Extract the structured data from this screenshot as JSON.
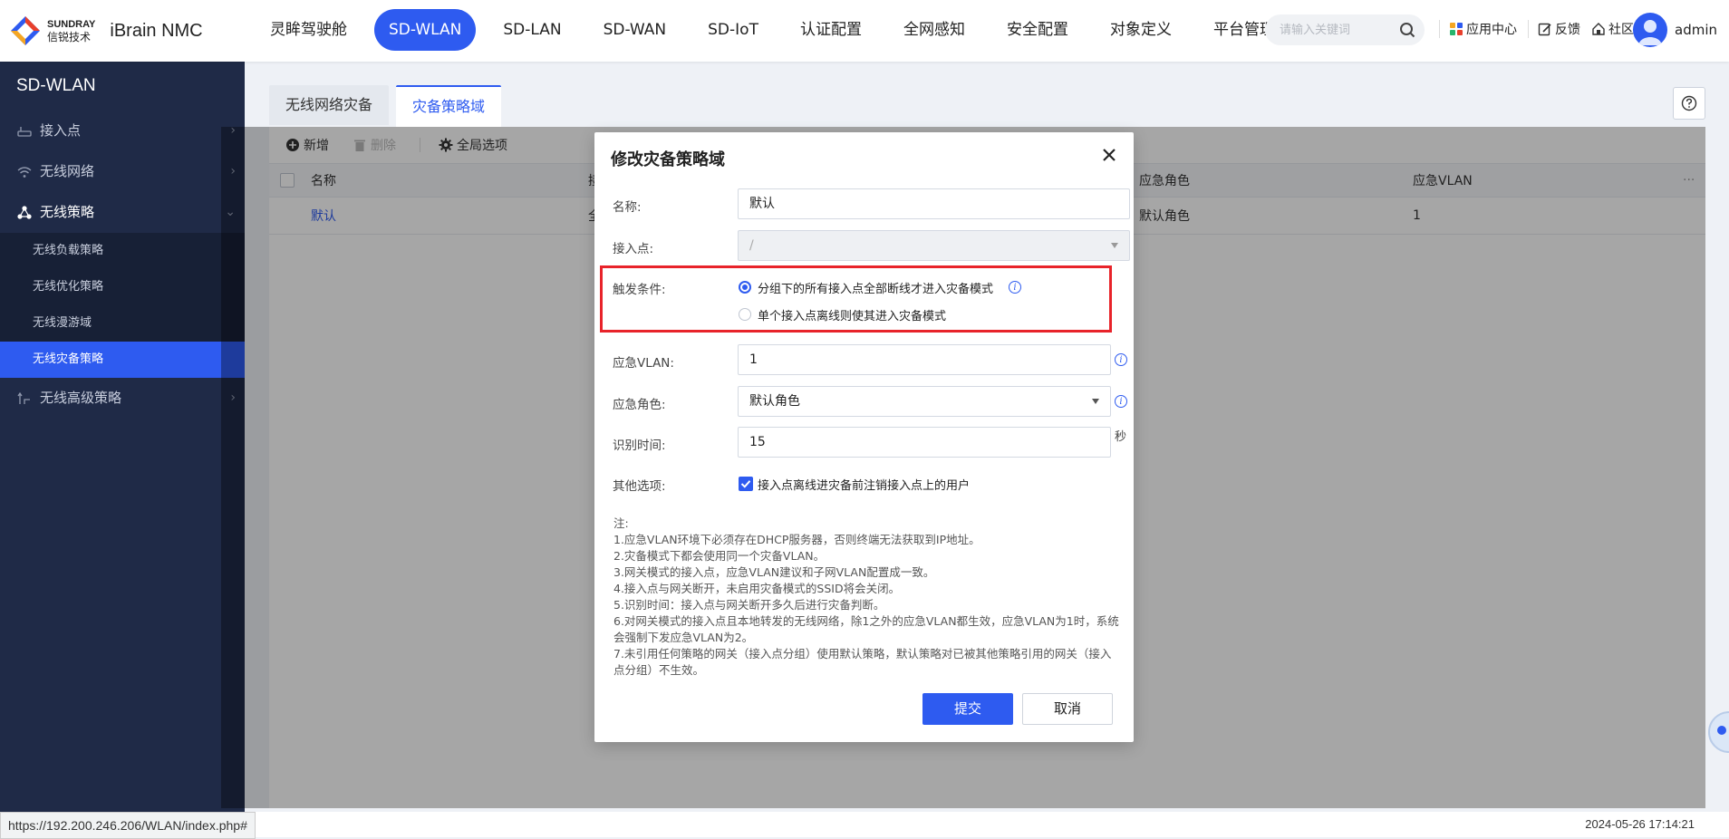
{
  "header": {
    "brand_en": "SUNDRAY",
    "brand_cn": "信锐技术",
    "product": "iBrain NMC",
    "nav": [
      "灵眸驾驶舱",
      "SD-WLAN",
      "SD-LAN",
      "SD-WAN",
      "SD-IoT",
      "认证配置",
      "全网感知",
      "安全配置",
      "对象定义",
      "平台管理"
    ],
    "nav_active": "SD-WLAN",
    "search_placeholder": "请输入关键词",
    "tools": {
      "app_center": "应用中心",
      "feedback": "反馈",
      "community": "社区"
    },
    "user": "admin"
  },
  "sidebar": {
    "title": "SD-WLAN",
    "items": [
      {
        "label": "接入点",
        "icon": "router-icon"
      },
      {
        "label": "无线网络",
        "icon": "wifi-icon"
      },
      {
        "label": "无线策略",
        "icon": "policy-icon",
        "open": true
      },
      {
        "label": "无线高级策略",
        "icon": "advanced-icon"
      }
    ],
    "sub_items": [
      "无线负载策略",
      "无线优化策略",
      "无线漫游域",
      "无线灾备策略"
    ],
    "sub_active": "无线灾备策略"
  },
  "tabs": [
    "无线网络灾备",
    "灾备策略域"
  ],
  "tab_active": "灾备策略域",
  "toolbar": {
    "add": "新增",
    "delete": "删除",
    "global": "全局选项"
  },
  "table": {
    "headers": [
      "名称",
      "接",
      "应急角色",
      "应急VLAN"
    ],
    "more": "···",
    "rows": [
      {
        "name": "默认",
        "ap": "全",
        "role": "默认角色",
        "vlan": "1"
      }
    ]
  },
  "modal": {
    "title": "修改灾备策略域",
    "name_label": "名称:",
    "name_value": "默认",
    "ap_label": "接入点:",
    "ap_value": "/",
    "trigger_label": "触发条件:",
    "trigger_option1": "分组下的所有接入点全部断线才进入灾备模式",
    "trigger_option2": "单个接入点离线则使其进入灾备模式",
    "trigger_selected": 1,
    "vlan_label": "应急VLAN:",
    "vlan_value": "1",
    "role_label": "应急角色:",
    "role_value": "默认角色",
    "time_label": "识别时间:",
    "time_value": "15",
    "time_unit": "秒",
    "other_label": "其他选项:",
    "other_option": "接入点离线进灾备前注销接入点上的用户",
    "other_checked": true,
    "notes": [
      "注:",
      "1.应急VLAN环境下必须存在DHCP服务器，否则终端无法获取到IP地址。",
      "2.灾备模式下都会使用同一个灾备VLAN。",
      "3.网关模式的接入点，应急VLAN建议和子网VLAN配置成一致。",
      "4.接入点与网关断开，未启用灾备模式的SSID将会关闭。",
      "5.识别时间：接入点与网关断开多久后进行灾备判断。",
      "6.对网关模式的接入点且本地转发的无线网络，除1之外的应急VLAN都生效，应急VLAN为1时，系统会强制下发应急VLAN为2。",
      "7.未引用任何策略的网关（接入点分组）使用默认策略，默认策略对已被其他策略引用的网关（接入点分组）不生效。"
    ],
    "submit": "提交",
    "cancel": "取消"
  },
  "status": {
    "url": "https://192.200.246.206/WLAN/index.php#",
    "datetime": "2024-05-26 17:14:21"
  },
  "colors": {
    "accent": "#2e5bf0",
    "sidebar": "#1f2a47",
    "highlight": "#e8232a"
  }
}
